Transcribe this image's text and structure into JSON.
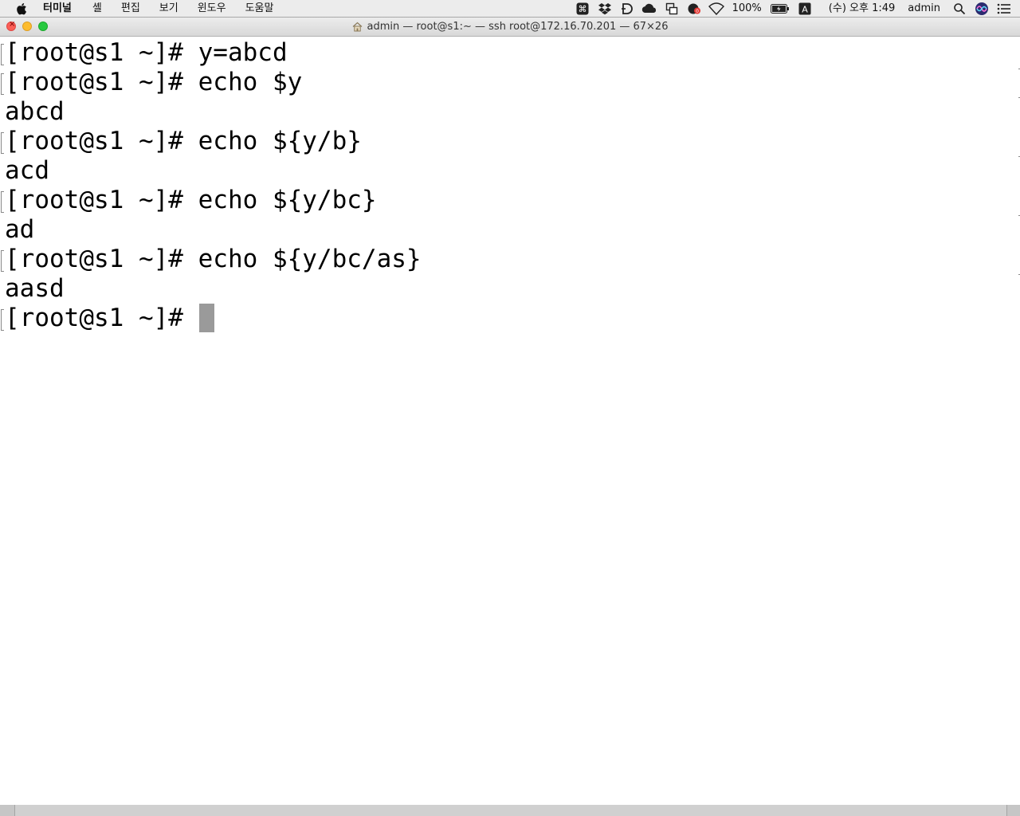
{
  "menubar": {
    "app_name": "터미널",
    "items": [
      "셸",
      "편집",
      "보기",
      "윈도우",
      "도움말"
    ],
    "battery": "100%",
    "input_source": "A",
    "clock": "(수) 오후 1:49",
    "user": "admin"
  },
  "window": {
    "title": "admin — root@s1:~ — ssh root@172.16.70.201 — 67×26"
  },
  "terminal": {
    "lines": [
      {
        "text": "[root@s1 ~]# y=abcd",
        "kind": "command"
      },
      {
        "text": "[root@s1 ~]# echo $y",
        "kind": "command"
      },
      {
        "text": "abcd",
        "kind": "output"
      },
      {
        "text": "[root@s1 ~]# echo ${y/b}",
        "kind": "command"
      },
      {
        "text": "acd",
        "kind": "output"
      },
      {
        "text": "[root@s1 ~]# echo ${y/bc}",
        "kind": "command"
      },
      {
        "text": "ad",
        "kind": "output"
      },
      {
        "text": "[root@s1 ~]# echo ${y/bc/as}",
        "kind": "command"
      },
      {
        "text": "aasd",
        "kind": "output"
      }
    ],
    "prompt": "[root@s1 ~]#"
  },
  "colors": {
    "menubar_bg": "#ececec",
    "terminal_bg": "#ffffff",
    "terminal_text": "#000000",
    "cursor": "#9a9a9a",
    "close": "#fc5f57",
    "minimize": "#fdbc2e",
    "zoom": "#28c940"
  },
  "icons": [
    "apple-icon",
    "command-icon",
    "dropbox-icon",
    "d-icon",
    "cloud-icon",
    "window-switch-icon",
    "notification-icon",
    "wifi-icon",
    "battery-icon",
    "search-icon",
    "siri-icon",
    "notification-center-icon",
    "home-icon"
  ]
}
